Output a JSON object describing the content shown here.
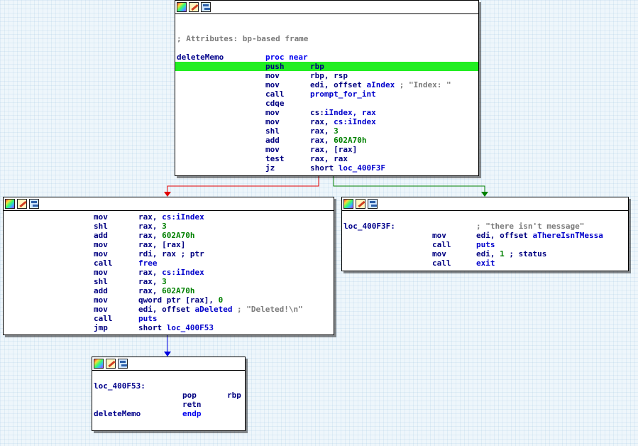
{
  "colors": {
    "true_edge": "#008000",
    "false_edge": "#e00000",
    "uncond_edge": "#0000e0",
    "highlight": "#22ee22"
  },
  "toolbar_icons": [
    "color-palette-icon",
    "edit-pencil-icon",
    "graph-view-icon"
  ],
  "node1": {
    "attributes_comment": "; Attributes: bp-based frame",
    "func_name": "deleteMemo",
    "proc_kw": "proc near",
    "lines": [
      {
        "m": "push",
        "o": "rbp"
      },
      {
        "m": "mov",
        "o": "rbp, rsp"
      },
      {
        "m": "mov",
        "o": "edi, offset aIndex",
        "c": "; \"Index: \""
      },
      {
        "m": "call",
        "o": "prompt_for_int"
      },
      {
        "m": "cdqe",
        "o": ""
      },
      {
        "m": "mov",
        "o": "cs:iIndex, rax"
      },
      {
        "m": "mov",
        "o": "rax, cs:iIndex"
      },
      {
        "m": "shl",
        "o": "rax, 3"
      },
      {
        "m": "add",
        "o": "rax, 602A70h"
      },
      {
        "m": "mov",
        "o": "rax, [rax]"
      },
      {
        "m": "test",
        "o": "rax, rax"
      },
      {
        "m": "jz",
        "o": "short loc_400F3F"
      }
    ]
  },
  "node2": {
    "lines": [
      {
        "m": "mov",
        "o": "rax, cs:iIndex"
      },
      {
        "m": "shl",
        "o": "rax, 3"
      },
      {
        "m": "add",
        "o": "rax, 602A70h"
      },
      {
        "m": "mov",
        "o": "rax, [rax]"
      },
      {
        "m": "mov",
        "o": "rdi, rax ; ptr"
      },
      {
        "m": "call",
        "o": "free"
      },
      {
        "m": "mov",
        "o": "rax, cs:iIndex"
      },
      {
        "m": "shl",
        "o": "rax, 3"
      },
      {
        "m": "add",
        "o": "rax, 602A70h"
      },
      {
        "m": "mov",
        "o": "qword ptr [rax], 0"
      },
      {
        "m": "mov",
        "o": "edi, offset aDeleted",
        "c": "; \"Deleted!\\n\""
      },
      {
        "m": "call",
        "o": "puts"
      },
      {
        "m": "jmp",
        "o": "short loc_400F53"
      }
    ]
  },
  "node3": {
    "label": "loc_400F3F:",
    "label_comment": "; \"there isn't message\"",
    "lines": [
      {
        "m": "mov",
        "o": "edi, offset aThereIsnTMessa"
      },
      {
        "m": "call",
        "o": "puts"
      },
      {
        "m": "mov",
        "o": "edi, 1 ; status"
      },
      {
        "m": "call",
        "o": "exit"
      }
    ]
  },
  "node4": {
    "label": "loc_400F53:",
    "lines": [
      {
        "m": "pop",
        "o": "rbp"
      },
      {
        "m": "retn",
        "o": ""
      }
    ],
    "func_name": "deleteMemo",
    "endp_kw": "endp"
  }
}
